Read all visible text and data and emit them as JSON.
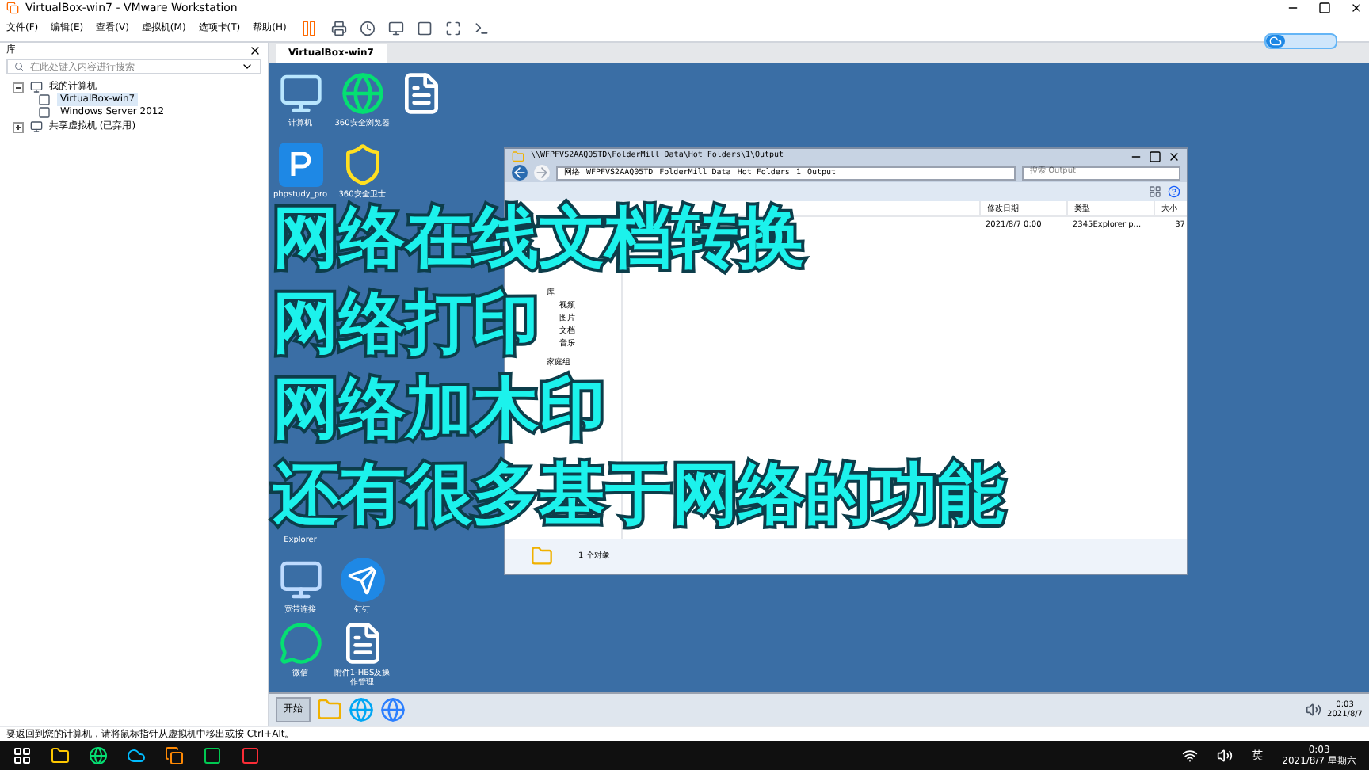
{
  "window": {
    "title": "VirtualBox-win7 - VMware Workstation"
  },
  "menu": [
    "文件(F)",
    "编辑(E)",
    "查看(V)",
    "虚拟机(M)",
    "选项卡(T)",
    "帮助(H)"
  ],
  "library": {
    "title": "库",
    "search": {
      "placeholder": "在此处键入内容进行搜索"
    },
    "tree": [
      {
        "label": "我的计算机",
        "expanded": true,
        "children": [
          {
            "label": "VirtualBox-win7",
            "selected": true
          },
          {
            "label": "Windows Server 2012",
            "selected": false
          }
        ]
      },
      {
        "label": "共享虚拟机 (已弃用)",
        "expanded": false
      }
    ]
  },
  "vm_tabs": [
    {
      "label": "VirtualBox-win7",
      "selected": true
    }
  ],
  "desktop_icons": [
    {
      "label": "计算机",
      "kind": "computer"
    },
    {
      "label": "360安全浏览器",
      "kind": "browser"
    },
    {
      "kind": "document"
    },
    {
      "label": "phpstudy_pro",
      "kind": "p"
    },
    {
      "label": "360安全卫士",
      "kind": "shield"
    },
    {
      "label": "Explorer",
      "kind": "covered"
    },
    {
      "label": "宽带连接",
      "kind": "network"
    },
    {
      "label": "钉钉",
      "kind": "bird"
    },
    {
      "label": "微信",
      "kind": "chat"
    },
    {
      "label": "附件1-HBS及操作管理",
      "kind": "document"
    }
  ],
  "explorer": {
    "title": "\\\\WFPFVS2AAQ05TD\\FolderMill Data\\Hot Folders\\1\\Output",
    "breadcrumb": [
      "网络",
      "WFPFVS2AAQ05TD",
      "FolderMill Data",
      "Hot Folders",
      "1",
      "Output"
    ],
    "search": {
      "placeholder": "搜索 Output"
    },
    "nav": [
      "库",
      "视频",
      "图片",
      "文档",
      "音乐",
      "家庭组"
    ],
    "columns": [
      "修改日期",
      "类型",
      "大小"
    ],
    "rows": [
      [
        "2021/8/7 0:00",
        "2345Explorer p...",
        "37"
      ]
    ],
    "status": "1 个对象"
  },
  "caption": [
    "网络在线文档转换",
    "网络打印",
    "网络加木印",
    "还有很多基于网络的功能"
  ],
  "guest_taskbar": {
    "start": "开始",
    "time": "0:03",
    "date": "2021/8/7"
  },
  "status_bar": "要返回到您的计算机，请将鼠标指针从虚拟机中移出或按 Ctrl+Alt。",
  "host_taskbar": {
    "ime": "英",
    "time": "0:03",
    "date": "2021/8/7 星期六"
  }
}
